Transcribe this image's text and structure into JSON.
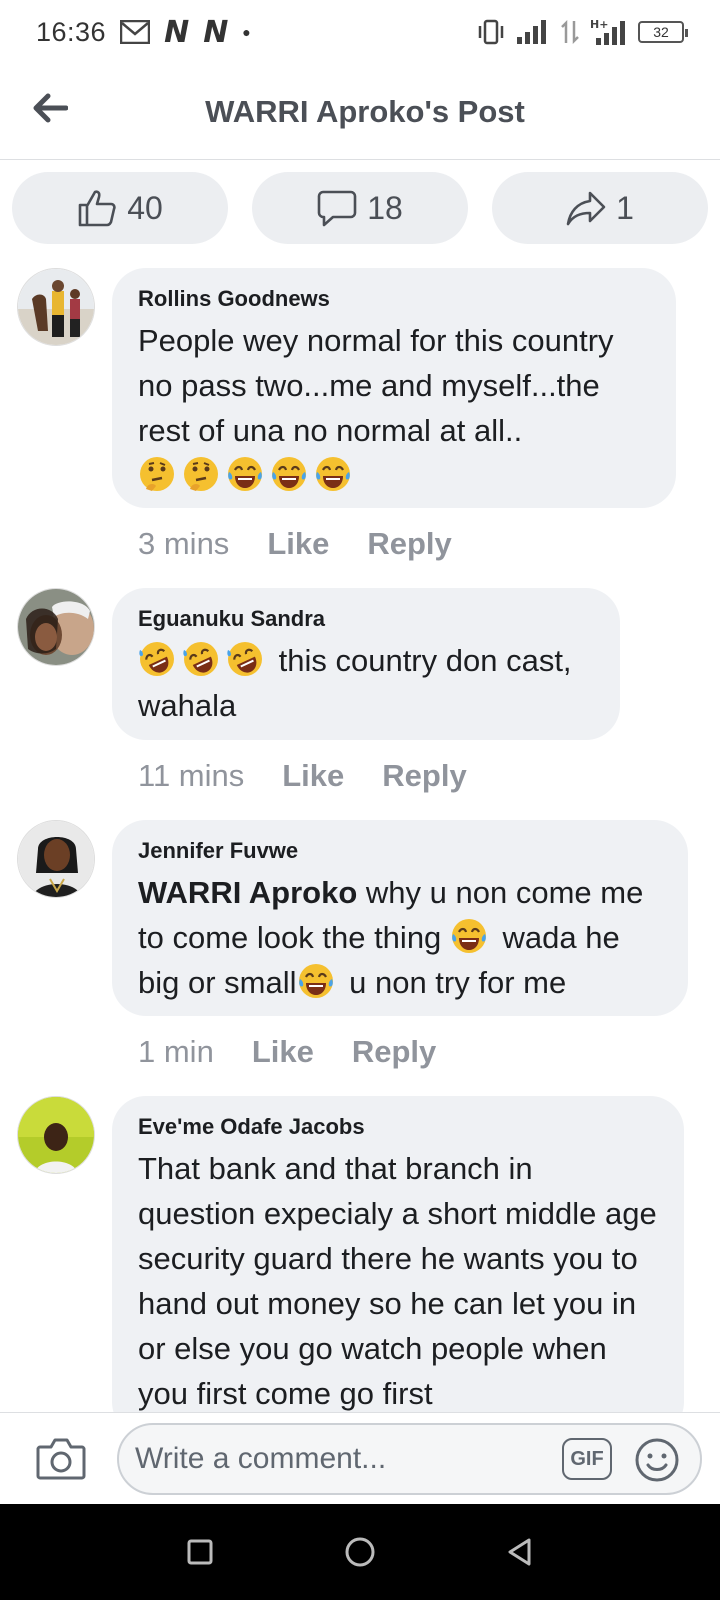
{
  "status_bar": {
    "time": "16:36",
    "battery": "32",
    "network": "H+"
  },
  "header": {
    "title": "WARRI Aproko's Post"
  },
  "actions": {
    "likes": "40",
    "comments": "18",
    "shares": "1"
  },
  "comments": [
    {
      "author": "Rollins Goodnews",
      "text": "People wey normal for this country no pass two...me and myself...the rest of una no normal at all..",
      "emojis": [
        "thinking-face",
        "thinking-face",
        "tears-of-joy",
        "tears-of-joy",
        "tears-of-joy"
      ],
      "time": "3 mins",
      "like": "Like",
      "reply": "Reply"
    },
    {
      "author": "Eguanuku Sandra",
      "text": " this country don cast, wahala",
      "emojis": [
        "rolling-laughing",
        "rolling-laughing",
        "rolling-laughing"
      ],
      "time": "11 mins",
      "like": "Like",
      "reply": "Reply"
    },
    {
      "author": "Jennifer Fuvwe",
      "mention": "WARRI Aproko",
      "text_part1": " why u non come me to come look the thing ",
      "text_part2": " wada he big or small",
      "text_part3": " u non try for me",
      "time": "1 min",
      "like": "Like",
      "reply": "Reply"
    },
    {
      "author": "Eve'me Odafe Jacobs",
      "text": "That bank and that branch in question expecialy a short middle age security guard there he wants you to hand out money so he can let you in or else you go watch people when you first come go first"
    }
  ],
  "compose": {
    "placeholder": "Write a comment...",
    "gif": "GIF"
  }
}
